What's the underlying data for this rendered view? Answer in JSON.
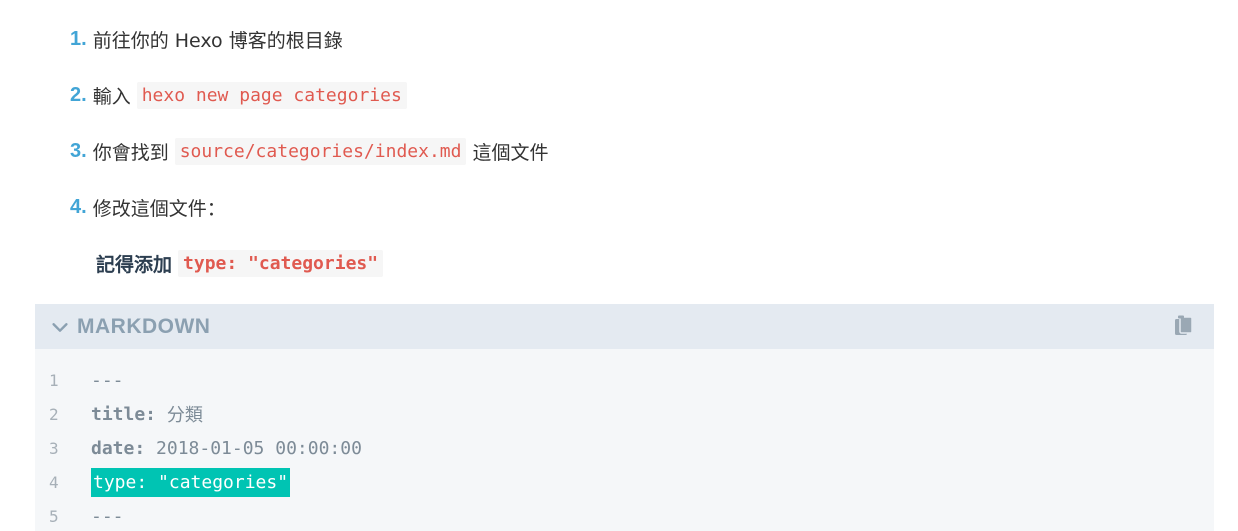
{
  "steps": [
    {
      "num": "1.",
      "text": "前往你的 Hexo 博客的根目錄"
    },
    {
      "num": "2.",
      "text_before": "輸入",
      "code": "hexo new page categories"
    },
    {
      "num": "3.",
      "text_before": "你會找到",
      "code": "source/categories/index.md",
      "text_after": "這個文件"
    },
    {
      "num": "4.",
      "text": "修改這個文件："
    }
  ],
  "note": {
    "text": "記得添加",
    "code": "type: \"categories\""
  },
  "code_block": {
    "language": "MARKDOWN",
    "collapse_icon": "chevron-down-icon",
    "copy_icon": "copy-icon",
    "lines": [
      {
        "num": "1",
        "text": "---"
      },
      {
        "num": "2",
        "key": "title:",
        "value": " 分類"
      },
      {
        "num": "3",
        "key": "date:",
        "value": " 2018-01-05 00:00:00"
      },
      {
        "num": "4",
        "highlight": "type: \"categories\""
      },
      {
        "num": "5",
        "text": "---"
      }
    ]
  },
  "colors": {
    "step_number": "#42a5d6",
    "inline_code": "#e05a50",
    "header_bg": "#e4eaf1",
    "highlight": "#00c4b3"
  }
}
